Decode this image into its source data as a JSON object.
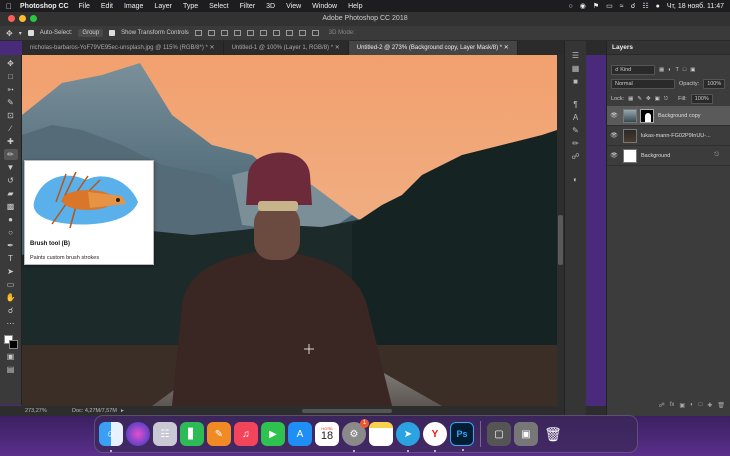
{
  "menubar": {
    "app_name": "Photoshop CC",
    "items": [
      "File",
      "Edit",
      "Image",
      "Layer",
      "Type",
      "Select",
      "Filter",
      "3D",
      "View",
      "Window",
      "Help"
    ],
    "clock": "Чт, 18 нояб.  11:47"
  },
  "window": {
    "title": "Adobe Photoshop CC 2018"
  },
  "options": {
    "auto_select_label": "Auto-Select:",
    "auto_select_value": "Group",
    "transform_label": "Show Transform Controls",
    "mode_3d": "3D Mode:"
  },
  "tabs": [
    {
      "label": "nicholas-barbaros-YoF79VE95ec-unsplash.jpg @ 115% (RGB/8*) *"
    },
    {
      "label": "Untitled-1 @ 100% (Layer 1, RGB/8) *"
    },
    {
      "label": "Untitled-2 @ 273% (Background copy, Layer Mask/8) *"
    }
  ],
  "tooltip": {
    "title": "Brush tool (B)",
    "description": "Paints custom brush strokes"
  },
  "status": {
    "zoom": "273,27%",
    "doc": "Doc: 4,27M/7,57M"
  },
  "layers": {
    "panel_title": "Layers",
    "kind_label": "Kind",
    "blend_mode": "Normal",
    "opacity_label": "Opacity:",
    "opacity_value": "100%",
    "lock_label": "Lock:",
    "fill_label": "Fill:",
    "fill_value": "100%",
    "items": [
      {
        "name": "Background copy"
      },
      {
        "name": "lukas-mann-FG02P9InUU-..."
      },
      {
        "name": "Background"
      }
    ]
  },
  "dock": {
    "calendar_month": "НОЯБ",
    "calendar_day": "18",
    "settings_badge": "1",
    "ps_label": "Ps"
  },
  "colors": {
    "accent": "#31a8ff",
    "sky": "#ef9a6a",
    "panel": "#3c3c3c"
  }
}
